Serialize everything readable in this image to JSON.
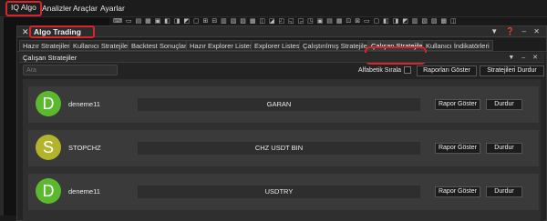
{
  "menu": {
    "items": [
      {
        "label": "IQ Algo",
        "active": true
      },
      {
        "label": "Analizler",
        "active": false
      },
      {
        "label": "Araçlar",
        "active": false
      },
      {
        "label": "Ayarlar",
        "active": false
      }
    ]
  },
  "toolbar": {
    "icons": "⌨ ▭ ▤ ▦ ▣ ◧ ◨ ◩ ▢ ⊞ ⊟ ▥ ▧ ▨ ▩ ◫ ◪ ◰ ◱ ◲ ◳ ▣ ▤ ▦ ⊡ ⊠ ▭ ▢ ◧ ◨ ◩ ▥ ▧ ▨ ▩ ◫"
  },
  "window": {
    "title": "Algo Trading",
    "controls": "▼ ❓ – ✕"
  },
  "tabs": [
    {
      "label": "Hazır Stratejiler",
      "active": false
    },
    {
      "label": "Kullanıcı Stratejileri",
      "active": false
    },
    {
      "label": "Backtest Sonuçları",
      "active": false
    },
    {
      "label": "Hazır Explorer Listesi",
      "active": false
    },
    {
      "label": "Explorer Listesi",
      "active": false
    },
    {
      "label": "Çalıştırılmış Stratejiler",
      "active": false
    },
    {
      "label": "Çalışan Stratejiler",
      "active": true
    },
    {
      "label": "Kullanıcı İndikatörleri",
      "active": false
    }
  ],
  "panel": {
    "title": "Çalışan Stratejiler",
    "controls": "▼ – ✕",
    "search_placeholder": "Ara",
    "alfabetik_label": "Alfabetik Sırala",
    "rapor_button": "Raporları Göster",
    "durdur_button": "Stratejileri Durdur"
  },
  "rows": [
    {
      "initial": "D",
      "avatar_color": "#5cb82e",
      "user": "deneme11",
      "symbol": "GARAN",
      "report": "Rapor Göster",
      "stop": "Durdur"
    },
    {
      "initial": "S",
      "avatar_color": "#b3b42d",
      "user": "STOPCHZ",
      "symbol": "CHZ USDT BIN",
      "report": "Rapor Göster",
      "stop": "Durdur"
    },
    {
      "initial": "D",
      "avatar_color": "#5cb82e",
      "user": "deneme11",
      "symbol": "USDTRY",
      "report": "Rapor Göster",
      "stop": "Durdur"
    }
  ],
  "colors": {
    "accent": "#d6262c"
  }
}
